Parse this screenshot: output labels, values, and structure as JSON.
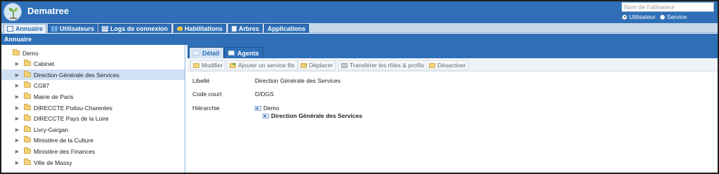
{
  "header": {
    "app_title": "Dematree",
    "search_placeholder": "Nom de l'utilisateur",
    "radio_options": [
      {
        "label": "Utilisateur",
        "selected": true
      },
      {
        "label": "Service",
        "selected": false
      }
    ]
  },
  "nav": {
    "tabs": [
      {
        "label": "Annuaire",
        "icon": "book-icon",
        "active": true
      },
      {
        "label": "Utilisateurs",
        "icon": "users-icon",
        "active": false
      },
      {
        "label": "Logs de connexion",
        "icon": "log-grid-icon",
        "active": false
      },
      {
        "label": "Habilitations",
        "icon": "key-icon",
        "active": false
      },
      {
        "label": "Arbres",
        "icon": "tree-doc-icon",
        "active": false
      },
      {
        "label": "Applications",
        "icon": "",
        "active": false
      }
    ]
  },
  "section": {
    "title": "Annuaire"
  },
  "tree": {
    "root": "Demo",
    "items": [
      {
        "label": "Cabinet",
        "selected": false
      },
      {
        "label": "Direction Générale des Services",
        "selected": true
      },
      {
        "label": "CG87",
        "selected": false
      },
      {
        "label": "Mairie de Paris",
        "selected": false
      },
      {
        "label": "DIRECCTE Poitou-Charentes",
        "selected": false
      },
      {
        "label": "DIRECCTE Pays de la Loire",
        "selected": false
      },
      {
        "label": "Livry-Gargan",
        "selected": false
      },
      {
        "label": "Ministère de la Culture",
        "selected": false
      },
      {
        "label": "Ministère des Finances",
        "selected": false
      },
      {
        "label": "Ville de Massy",
        "selected": false
      }
    ]
  },
  "detail": {
    "tabs": [
      {
        "label": "Détail",
        "active": true
      },
      {
        "label": "Agents",
        "active": false
      }
    ],
    "toolbar": {
      "modify": "Modifier",
      "add_child": "Ajouter un service fils",
      "move": "Déplacer",
      "transfer": "Transférer les rôles & profils",
      "deactivate": "Désactiver"
    },
    "fields": {
      "libelle_label": "Libellé",
      "libelle_value": "Direction Générale des Services",
      "code_label": "Code court",
      "code_value": "D/DGS",
      "hier_label": "Hiérarchie",
      "hier_root": "Demo",
      "hier_child": "Direction Générale des Services"
    }
  },
  "colors": {
    "header_blue": "#2e6fb7",
    "nav_background": "#c7d8ea",
    "selected_row": "#cfe1f3"
  }
}
